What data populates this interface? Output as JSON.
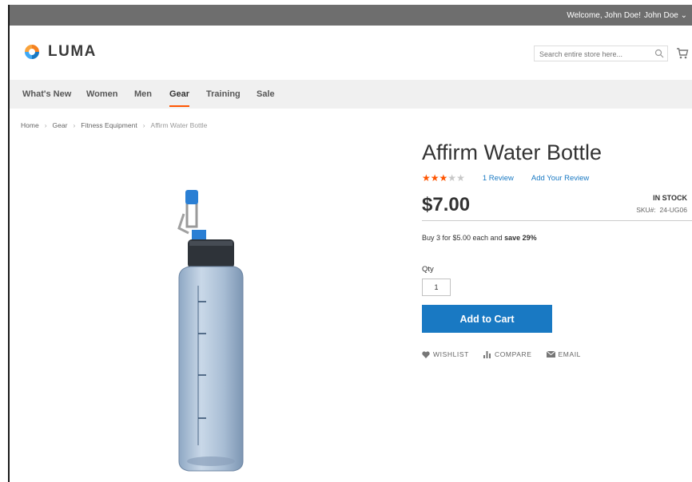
{
  "topbar": {
    "welcome": "Welcome, John Doe!",
    "user_menu": "John Doe"
  },
  "logo": {
    "text": "LUMA"
  },
  "search": {
    "placeholder": "Search entire store here..."
  },
  "nav": {
    "items": [
      "What's New",
      "Women",
      "Men",
      "Gear",
      "Training",
      "Sale"
    ],
    "active": "Gear"
  },
  "breadcrumbs": [
    "Home",
    "Gear",
    "Fitness Equipment",
    "Affirm Water Bottle"
  ],
  "product": {
    "name": "Affirm Water Bottle",
    "rating_stars": 3,
    "rating_max": 5,
    "review_link": "1 Review",
    "add_review_link": "Add Your Review",
    "price": "$7.00",
    "stock": "IN STOCK",
    "sku_label": "SKU#:",
    "sku": "24-UG06",
    "tier_text": "Buy 3 for $5.00 each and",
    "tier_save": "save 29%",
    "qty_label": "Qty",
    "qty_value": "1",
    "add_to_cart": "Add to Cart",
    "actions": {
      "wishlist": "WISHLIST",
      "compare": "COMPARE",
      "email": "EMAIL"
    }
  },
  "colors": {
    "accent": "#1979c3",
    "star": "#ff5501",
    "nav_active_underline": "#ff5501"
  }
}
